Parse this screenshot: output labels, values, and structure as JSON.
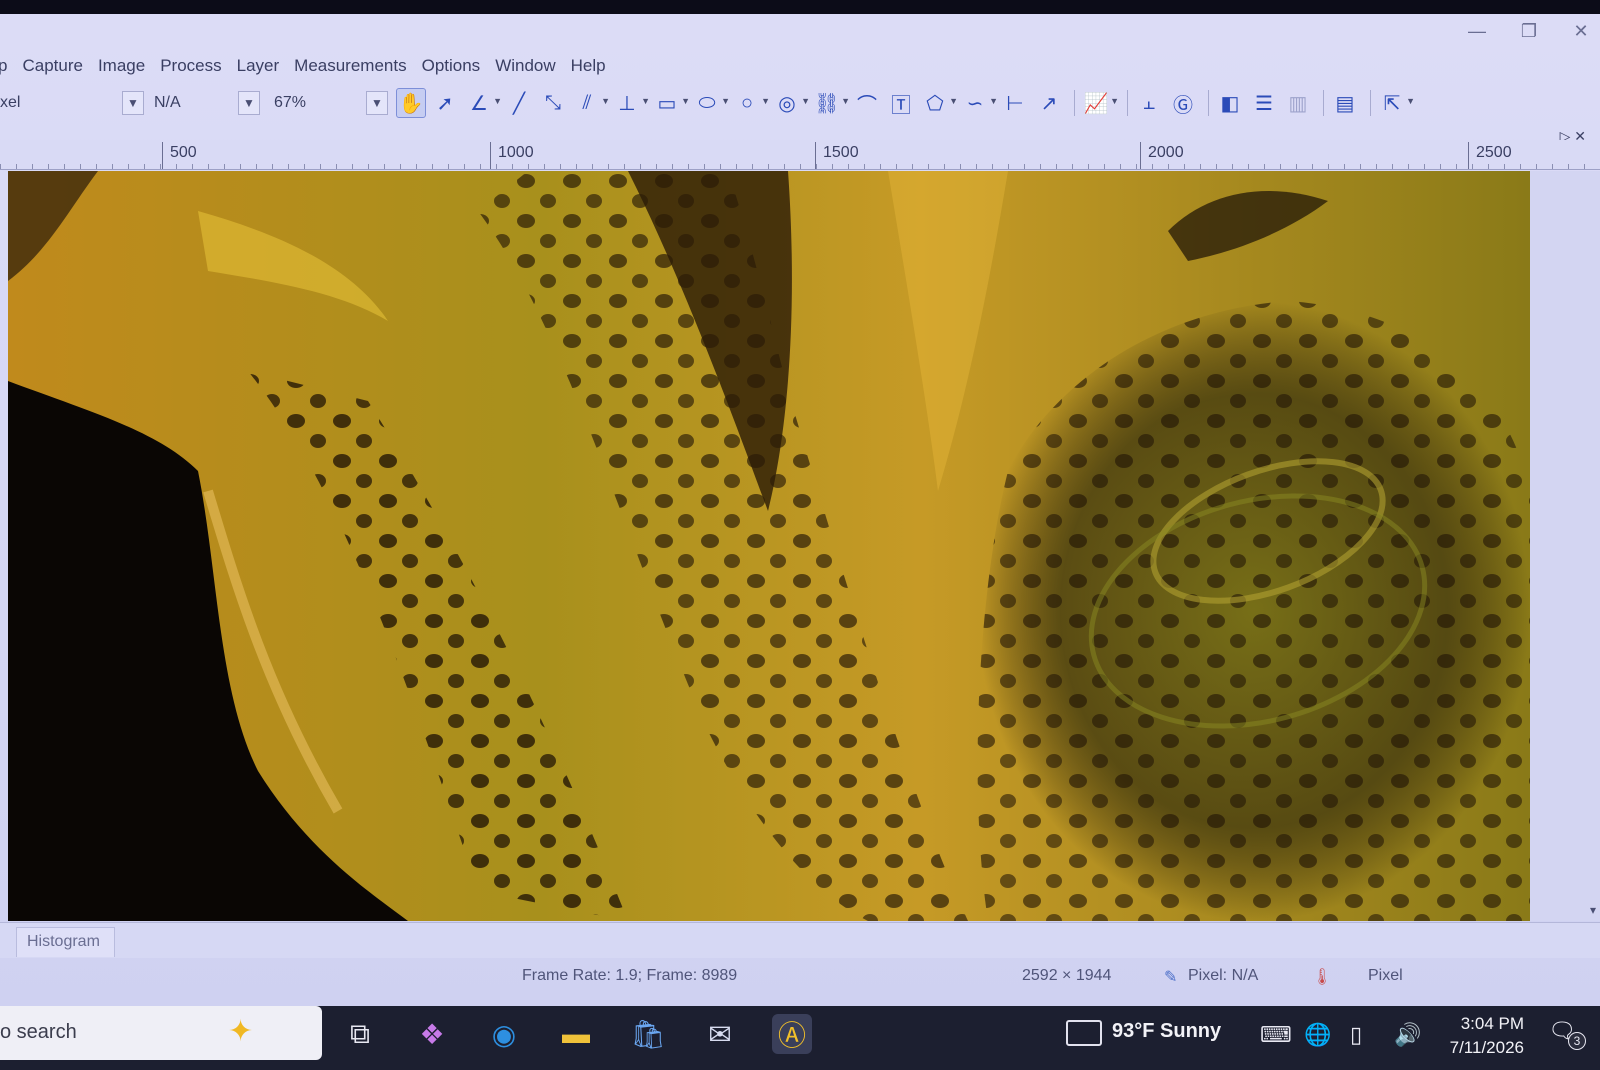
{
  "window": {
    "controls": [
      "—",
      "❐",
      "✕"
    ]
  },
  "menu": [
    "p",
    "Capture",
    "Image",
    "Process",
    "Layer",
    "Measurements",
    "Options",
    "Window",
    "Help"
  ],
  "toolbar": {
    "unit_value": "xel",
    "calibration_value": "N/A",
    "zoom_value": "67%"
  },
  "tool_icons": [
    "hand-pan-icon",
    "select-arrow-icon",
    "angle-icon",
    "line-icon",
    "point-line-icon",
    "parallel-lines-icon",
    "perpendicular-icon",
    "rectangle-icon",
    "ellipse-icon",
    "circle-icon",
    "concentric-circle-icon",
    "link-icon",
    "arc-icon",
    "text-icon",
    "polygon-icon",
    "curve-icon",
    "scale-bar-icon",
    "arrow-icon",
    "chart-icon",
    "alignment-icon",
    "grid-icon",
    "layer-icon",
    "stack-icon",
    "column-icon",
    "report-icon",
    "export-icon"
  ],
  "ruler": {
    "labels": [
      "500",
      "1000",
      "1500",
      "2000",
      "2500"
    ]
  },
  "canvas": {
    "description_colors": [
      "#c8a020",
      "#7a6a10",
      "#1a0f05"
    ]
  },
  "panels": {
    "tab_label": "Histogram"
  },
  "status": {
    "frame_info": "Frame Rate: 1.9; Frame: 8989",
    "resolution": "2592 × 1944",
    "pixel_value": "Pixel: N/A",
    "unit": "Pixel"
  },
  "taskbar": {
    "search_text": "o search",
    "weather": "93°F  Sunny",
    "time": "3:04 PM",
    "date": "7/11/2026",
    "notification_count": "3"
  }
}
